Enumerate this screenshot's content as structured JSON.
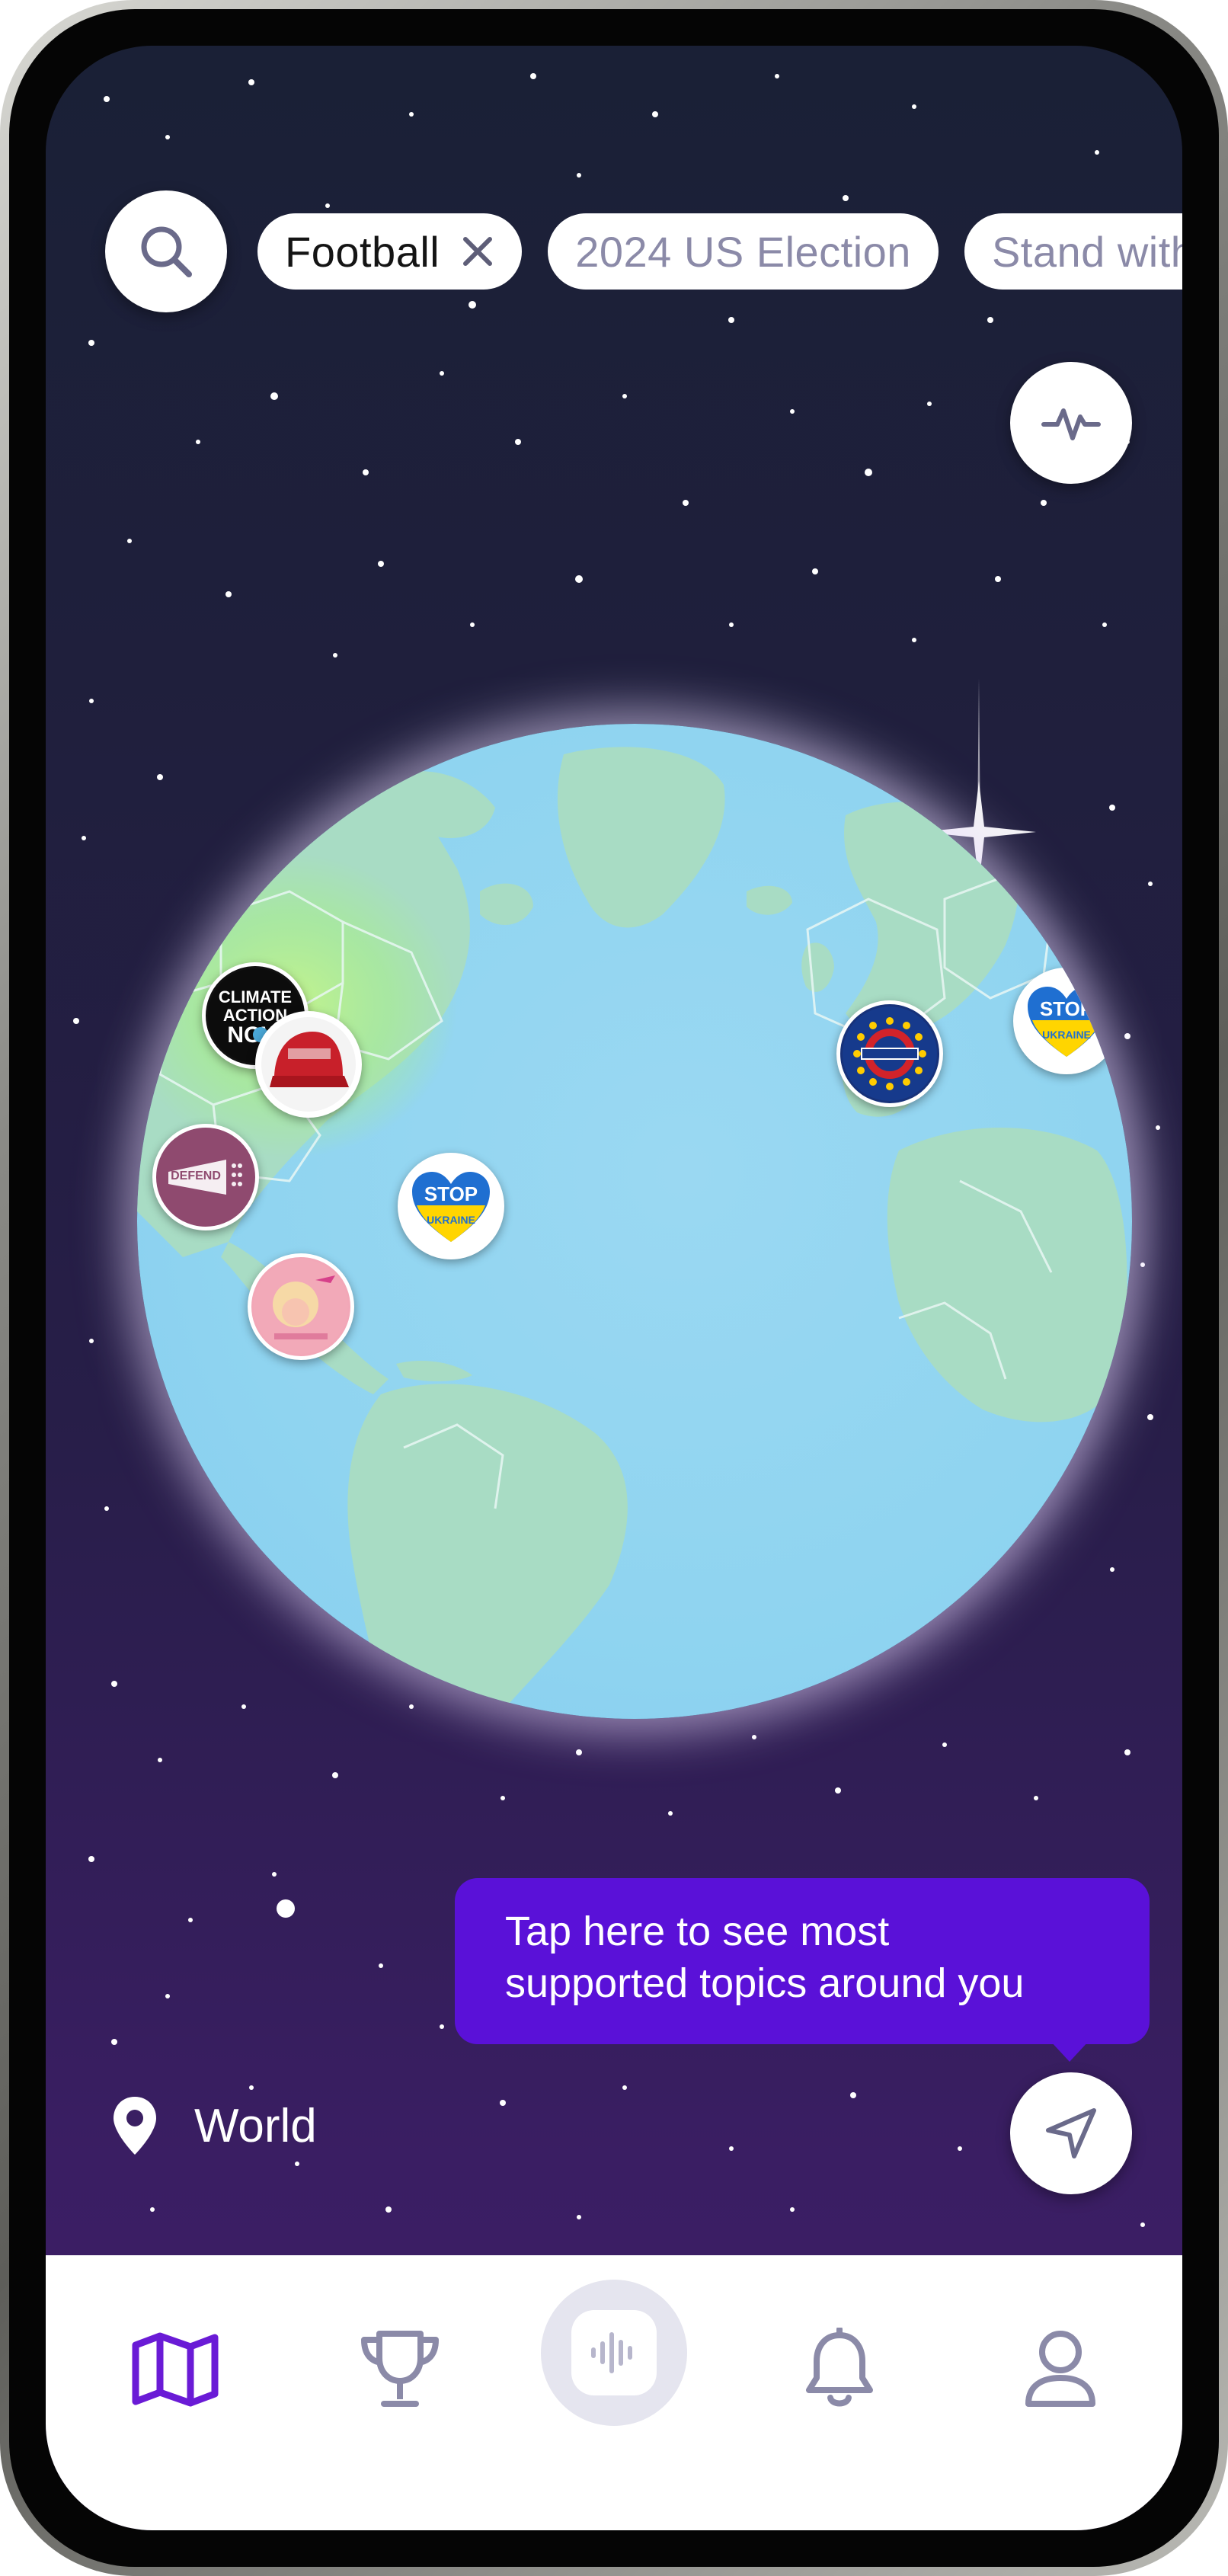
{
  "search": {
    "icon": "search-icon"
  },
  "chips": [
    {
      "label": "Football",
      "active": true,
      "icon": "close-icon"
    },
    {
      "label": "2024 US Election",
      "active": false
    },
    {
      "label": "Stand with",
      "active": false
    }
  ],
  "activity": {
    "icon": "pulse-icon"
  },
  "globe": {
    "pins": [
      {
        "topic": "climate-action-now",
        "label": "CLIMATE ACTION NOW"
      },
      {
        "topic": "make-america-great-again",
        "label": "MAKE AMERICA GREAT AGAIN"
      },
      {
        "topic": "defend-free-speech",
        "label": "DEFEND FREE SPEECH"
      },
      {
        "topic": "stop-war-in-ukraine-us",
        "label": "STOP WAR IN UKRAINE"
      },
      {
        "topic": "pink-portrait-topic",
        "label": ""
      },
      {
        "topic": "brexit",
        "label": "BREXIT"
      },
      {
        "topic": "stop-war-in-ukraine-europe",
        "label": "STOP WAR IN UKRAINE"
      }
    ]
  },
  "tooltip": {
    "line1": "Tap here to see most",
    "line2": "supported topics around you"
  },
  "location": {
    "label": "World",
    "icon": "location-pin-icon"
  },
  "nearby": {
    "icon": "navigation-arrow-icon"
  },
  "tabbar": {
    "items": [
      {
        "name": "map",
        "icon": "map-icon",
        "active": true
      },
      {
        "name": "leaderboard",
        "icon": "trophy-icon",
        "active": false
      },
      {
        "name": "record",
        "icon": "audio-wave-icon",
        "active": false
      },
      {
        "name": "notifications",
        "icon": "bell-icon",
        "active": false
      },
      {
        "name": "profile",
        "icon": "user-icon",
        "active": false
      }
    ]
  },
  "colors": {
    "accent": "#5a11d8",
    "tab_inactive": "#8b8aa8",
    "ocean": "#8fd4f0",
    "land": "#a8dcc4"
  }
}
